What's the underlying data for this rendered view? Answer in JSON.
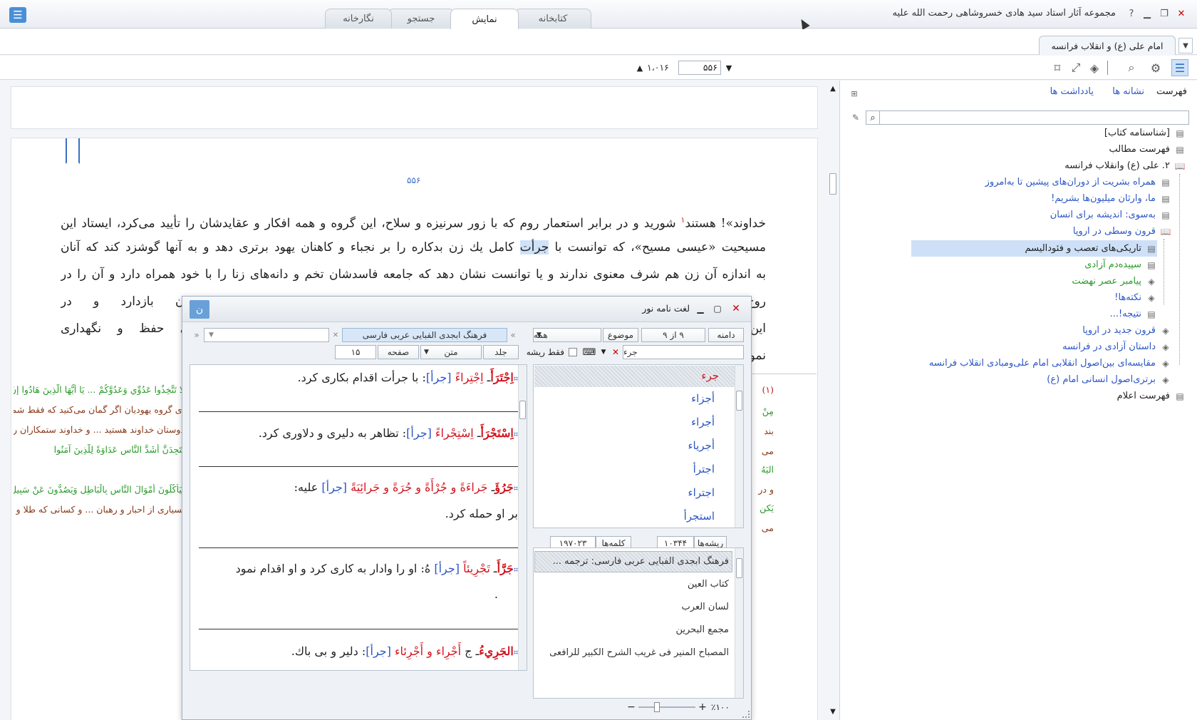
{
  "app": {
    "title": "مجموعه آثار استاد سید هادی خسروشاهی رحمت الله علیه"
  },
  "tabs": [
    {
      "label": "کتابخانه"
    },
    {
      "label": "نمایش"
    },
    {
      "label": "جستجو"
    },
    {
      "label": "نگارخانه"
    }
  ],
  "document_tab": {
    "label": "امام علی (ع) و انقلاب فرانسه"
  },
  "pager": {
    "current": "۵۵۶",
    "total": "۱،۰۱۶"
  },
  "sidebar": {
    "links": {
      "toc": "فهرست",
      "bookmarks": "نشانه ها",
      "notes": "یادداشت ها"
    },
    "tree": [
      {
        "label": "[شناسنامه کتاب]"
      },
      {
        "label": "فهرست مطالب"
      },
      {
        "label": "۲. علی (ع) وانقلاب فرانسه"
      },
      {
        "label": "همراه بشریت از دوران‌های پیشین تا به‌امروز"
      },
      {
        "label": "ما، وارثان میلیون‌ها بشریم!"
      },
      {
        "label": "به‌سوی: اندیشه برای انسان"
      },
      {
        "label": "قرون وسطی در اروپا"
      },
      {
        "label": "تاریکی‌های تعصب و فئودالیسم"
      },
      {
        "label": "سپیده‌دم آزادی"
      },
      {
        "label": "پیامبر عصر نهضت"
      },
      {
        "label": "نکته‌ها!"
      },
      {
        "label": "نتیجه!..."
      },
      {
        "label": "قرون جدید در اروپا"
      },
      {
        "label": "داستان آزادی در فرانسه"
      },
      {
        "label": "مقایسه‌ای بین‌اصول انقلابی امام علی‌ومبادی انقلاب فرانسه"
      },
      {
        "label": "برتری‌اصول انسانی امام (ع)"
      },
      {
        "label": "فهرست اعلام"
      }
    ]
  },
  "page": {
    "number": "۵۵۶",
    "lines": [
      {
        "pre": "خداوند»! هستند",
        "sup": "۱",
        "post": " شورید و در برابر استعمار روم که با زور سرنیزه و سلاح، این گروه و همه افکار و عقایدشان را تأیید می‌کرد، ایستاد این"
      },
      {
        "pre": "مسیحیت «عیسی مسیح»، که توانست با ",
        "hl": "جرأت",
        "post": " کامل یك زن بدکاره را بر نجباء و کاهنان یهود برتری دهد و به آنها گوشزد کند که آنان"
      },
      {
        "text": "به اندازه آن زن هم شرف معنوی ندارند و یا توانست نشان دهد که جامعه فاسدشان تخم و دانه‌های زنا را با خود همراه دارد و آن را در"
      },
      {
        "text": "روح و روان خود پرورش داده است ... و این در حقیقت ارزش‌های انسان بازدارد و در"
      },
      {
        "text": "این راه بود که ارزش‌های معنوی را در جامعه بشری بر جای نهاد و مفاهیم روحانی حفظ و نگهداری"
      },
      {
        "text": "نمود."
      }
    ],
    "footnotes_left": [
      "لَا تَتَّخِذُوا عَدُوِّي وَعَدُوَّكُمْ ... يَا أَيُّهَا الَّذِينَ هَادُوا إِنْ زَعَمْتُمْ أَنَّكُمْ أَوْلِيَاءُ لِلَّهِ",
      "ای گروه یهودیان اگر گمان می‌کنید که فقط شما نه مردم دیگر",
      "دوستان خداوند هستید ... و خداوند ستمکاران را به‌خوبی",
      "لَتَجِدَنَّ أَشَدَّ النَّاسِ عَدَاوَةً لِلَّذِينَ آمَنُوا",
      "لَيَأْكُلُونَ أَمْوَالَ النَّاسِ بِالْبَاطِلِ وَيَصُدُّونَ عَنْ سَبِيلِ اللَّهِ وَالَّذِينَ",
      "بسیاری از احبار و رهبان ... و کسانی که طلا و نقره را گنج"
    ],
    "footnotes_right": [
      "(۱)",
      "مِنْ",
      "بند",
      "می",
      "الیَهُ",
      "و در",
      "یَکنِ",
      "می"
    ]
  },
  "dict": {
    "title": "لغت نامه نور",
    "search": {
      "scope": "دامنه",
      "count": "۹ از ۹",
      "topic": "موضوع",
      "all": "همه",
      "value": "جرء",
      "root_only": "فقط ریشه"
    },
    "source": {
      "name": "فرهنگ ابجدی الفبایی عربی فارسی",
      "vol": "جلد",
      "text": "متن",
      "page": "صفحه",
      "page_val": "۱۵"
    },
    "words": [
      "جرء",
      "أجزاء",
      "أجراء",
      "أجرياء",
      "اجترأ",
      "اجتراء",
      "استجرأ"
    ],
    "stats": {
      "roots_label": "ریشه‌ها",
      "roots": "۱۰۳۴۴",
      "words_label": "کلمه‌ها",
      "words": "۱۹۷۰۲۳"
    },
    "dictionaries": [
      "فرهنگ ابجدی الفبایی عربی  فارسی: ترجمه ...",
      "كتاب العين",
      "لسان العرب",
      "مجمع البحرين",
      "المصباح المنير فى غريب الشرح الكبير للرافعى"
    ],
    "entries": [
      {
        "hw": "اِجْتَرَأَ",
        "dv": "اِجْتِراءً",
        "root": "[جرأ]",
        "def": ": با جرأت اقدام بكارى كرد."
      },
      {
        "hw": "اِسْتَجْرَأَ",
        "dv": "اِسْتِجْراءً",
        "root": "[جرأ]",
        "def": ": تظاهر به دليرى و دلاورى كرد."
      },
      {
        "hw": "جَرُؤَ",
        "dv": "جَراءَةً و جُرْأَةً و جُرَةً و جَرائِيَةً",
        "root": "[جرأ]",
        "def": " عليه:",
        "line2": "بر او حمله كرد."
      },
      {
        "hw": "جَرَّأَ",
        "dv": "تَجْرِيئاً",
        "root": "[جرأ]",
        "def": " هُ: او را وادار به كارى كرد و او اقدام نمود",
        "line2": "."
      },
      {
        "hw": "الجَرِيءُ",
        "dv": "أَجْرِاء و أَجْرِئاء",
        "root": "[جرأ]",
        "def": ": دلير و بى باك.",
        "pre": "ـ ج "
      }
    ],
    "zoom": "٪۱۰۰"
  },
  "colors": {
    "accent": "#2b56c4",
    "headword": "#d2141e",
    "selection": "#cde0f7",
    "green": "#2a9a2a"
  }
}
